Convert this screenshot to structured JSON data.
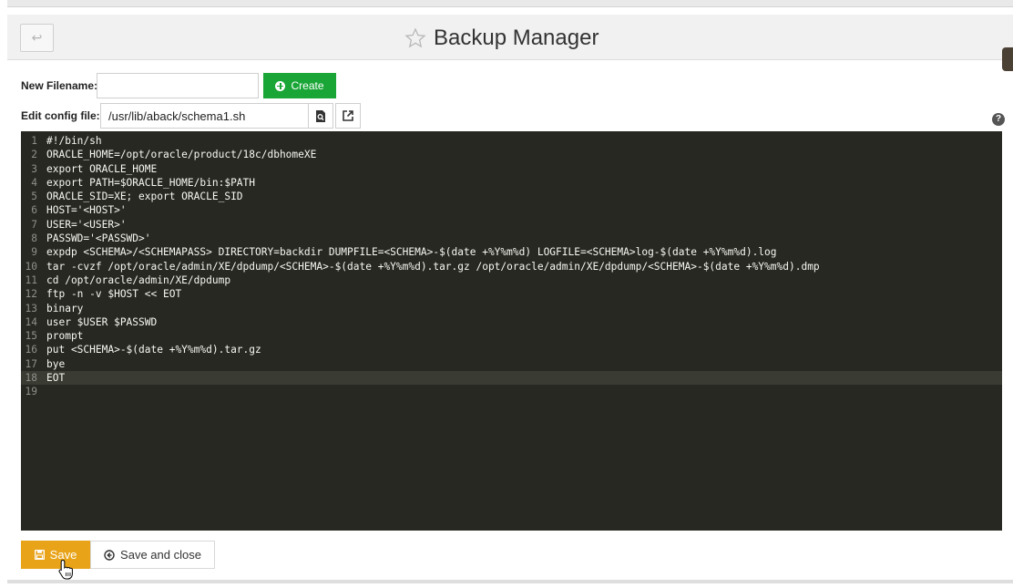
{
  "header": {
    "title": "Backup Manager",
    "back_glyph": "↩"
  },
  "form": {
    "new_filename_label": "New Filename:",
    "new_filename_value": "",
    "create_label": "Create",
    "edit_config_label": "Edit config file:",
    "config_file_selected": "/usr/lib/aback/schema1.sh"
  },
  "help_glyph": "?",
  "editor": {
    "active_line": 18,
    "lines": [
      {
        "n": "1",
        "code": "#!/bin/sh"
      },
      {
        "n": "2",
        "code": "ORACLE_HOME=/opt/oracle/product/18c/dbhomeXE"
      },
      {
        "n": "3",
        "code": "export ORACLE_HOME"
      },
      {
        "n": "4",
        "code": "export PATH=$ORACLE_HOME/bin:$PATH"
      },
      {
        "n": "5",
        "code": "ORACLE_SID=XE; export ORACLE_SID"
      },
      {
        "n": "6",
        "code": "HOST='<HOST>'"
      },
      {
        "n": "7",
        "code": "USER='<USER>'"
      },
      {
        "n": "8",
        "code": "PASSWD='<PASSWD>'"
      },
      {
        "n": "9",
        "code": "expdp <SCHEMA>/<SCHEMAPASS> DIRECTORY=backdir DUMPFILE=<SCHEMA>-$(date +%Y%m%d) LOGFILE=<SCHEMA>log-$(date +%Y%m%d).log"
      },
      {
        "n": "10",
        "code": "tar -cvzf /opt/oracle/admin/XE/dpdump/<SCHEMA>-$(date +%Y%m%d).tar.gz /opt/oracle/admin/XE/dpdump/<SCHEMA>-$(date +%Y%m%d).dmp"
      },
      {
        "n": "11",
        "code": "cd /opt/oracle/admin/XE/dpdump"
      },
      {
        "n": "12",
        "code": "ftp -n -v $HOST << EOT"
      },
      {
        "n": "13",
        "code": "binary"
      },
      {
        "n": "14",
        "code": "user $USER $PASSWD"
      },
      {
        "n": "15",
        "code": "prompt"
      },
      {
        "n": "16",
        "code": "put <SCHEMA>-$(date +%Y%m%d).tar.gz"
      },
      {
        "n": "17",
        "code": "bye"
      },
      {
        "n": "18",
        "code": "EOT"
      },
      {
        "n": "19",
        "code": ""
      }
    ]
  },
  "footer": {
    "save_label": "Save",
    "save_close_label": "Save and close"
  },
  "colors": {
    "create_green": "#1aa637",
    "save_orange": "#e8a319",
    "editor_bg": "#272822"
  }
}
